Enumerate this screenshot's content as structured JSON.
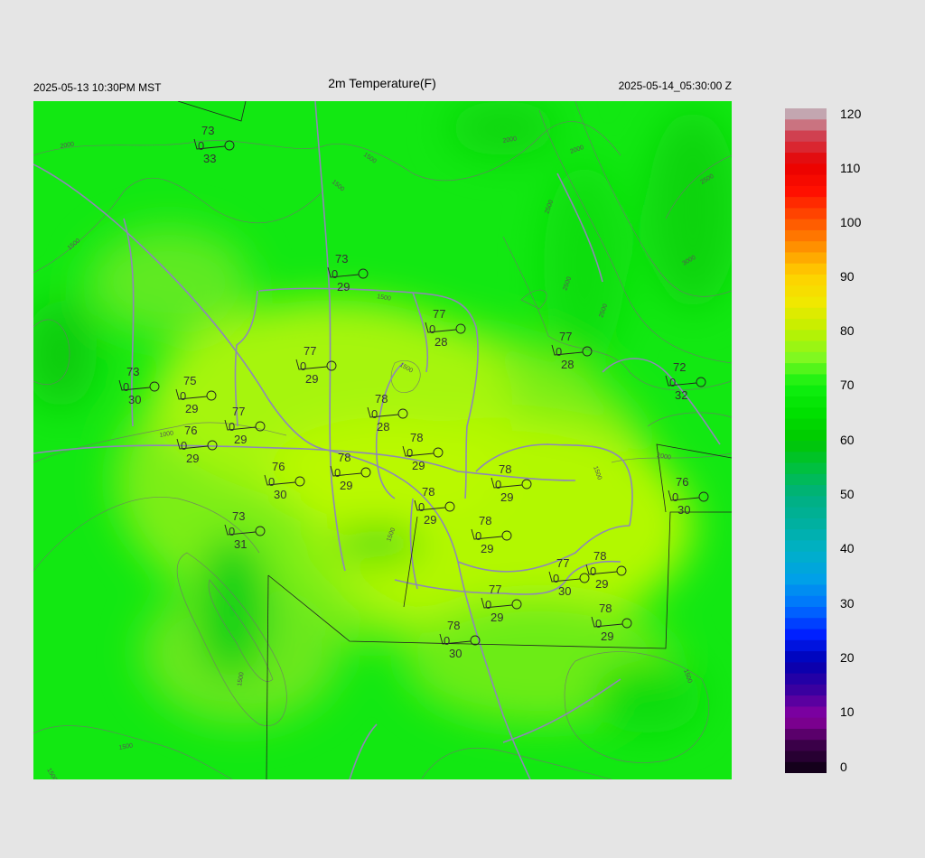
{
  "header": {
    "title": "2m Temperature(F)",
    "local_time": "2025-05-13 10:30PM MST",
    "utc_time": "2025-05-14_05:30:00 Z"
  },
  "colorbar": {
    "ticks": [
      "120",
      "110",
      "100",
      "90",
      "80",
      "70",
      "60",
      "50",
      "40",
      "30",
      "20",
      "10",
      "0"
    ],
    "range": [
      0,
      120
    ]
  },
  "contour_labels": [
    "2000",
    "1500",
    "2000",
    "2000",
    "2500",
    "2500",
    "3000",
    "2500",
    "2500",
    "1500",
    "1500",
    "1500",
    "1000",
    "2000",
    "1500",
    "1500",
    "1500",
    "1500",
    "1500",
    "1500",
    "1500"
  ],
  "stations": [
    {
      "t": "73",
      "z": "0",
      "td": "33"
    },
    {
      "t": "73",
      "z": "0",
      "td": "29"
    },
    {
      "t": "77",
      "z": "0",
      "td": "28"
    },
    {
      "t": "77",
      "z": "0",
      "td": "28"
    },
    {
      "t": "77",
      "z": "0",
      "td": "29"
    },
    {
      "t": "73",
      "z": "0",
      "td": "30"
    },
    {
      "t": "75",
      "z": "0",
      "td": "29"
    },
    {
      "t": "72",
      "z": "0",
      "td": "32"
    },
    {
      "t": "78",
      "z": "0",
      "td": "28"
    },
    {
      "t": "77",
      "z": "0",
      "td": "29"
    },
    {
      "t": "76",
      "z": "0",
      "td": "29"
    },
    {
      "t": "78",
      "z": "0",
      "td": "29"
    },
    {
      "t": "78",
      "z": "0",
      "td": "29"
    },
    {
      "t": "78",
      "z": "0",
      "td": "29"
    },
    {
      "t": "76",
      "z": "0",
      "td": "30"
    },
    {
      "t": "78",
      "z": "0",
      "td": "29"
    },
    {
      "t": "76",
      "z": "0",
      "td": "30"
    },
    {
      "t": "78",
      "z": "0",
      "td": "29"
    },
    {
      "t": "73",
      "z": "0",
      "td": "31"
    },
    {
      "t": "78",
      "z": "0",
      "td": "29"
    },
    {
      "t": "77",
      "z": "0",
      "td": "29"
    },
    {
      "t": "78",
      "z": "0",
      "td": "29"
    },
    {
      "t": "78",
      "z": "0",
      "td": "30"
    },
    {
      "t": "77",
      "z": "0",
      "td": "30"
    }
  ]
}
